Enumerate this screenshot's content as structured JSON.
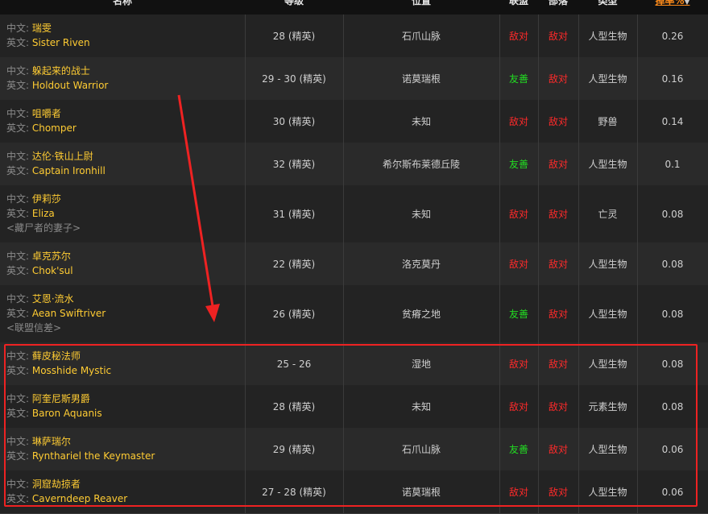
{
  "header": {
    "col_name": "名称",
    "col_level": "等级",
    "col_location": "位置",
    "col_alliance": "联盟",
    "col_horde": "部落",
    "col_type": "类型",
    "col_rate": "掉率%",
    "sort_icon": "chevron-down-icon"
  },
  "labels": {
    "zh": "中文: ",
    "en": "英文: "
  },
  "rows": [
    {
      "zh": "瑞雯",
      "en": "Sister Riven",
      "note": "",
      "level": "28 (精英)",
      "location": "石爪山脉",
      "alliance": "敌对",
      "horde": "敌对",
      "type": "人型生物",
      "rate": "0.26"
    },
    {
      "zh": "躲起来的战士",
      "en": "Holdout Warrior",
      "note": "",
      "level": "29 - 30 (精英)",
      "location": "诺莫瑞根",
      "alliance": "友善",
      "horde": "敌对",
      "type": "人型生物",
      "rate": "0.16"
    },
    {
      "zh": "咀嚼者",
      "en": "Chomper",
      "note": "",
      "level": "30 (精英)",
      "location": "未知",
      "alliance": "敌对",
      "horde": "敌对",
      "type": "野兽",
      "rate": "0.14"
    },
    {
      "zh": "达伦·铁山上尉",
      "en": "Captain Ironhill",
      "note": "",
      "level": "32 (精英)",
      "location": "希尔斯布莱德丘陵",
      "alliance": "友善",
      "horde": "敌对",
      "type": "人型生物",
      "rate": "0.1"
    },
    {
      "zh": "伊莉莎",
      "en": "Eliza",
      "note": "<藏尸者的妻子>",
      "level": "31 (精英)",
      "location": "未知",
      "alliance": "敌对",
      "horde": "敌对",
      "type": "亡灵",
      "rate": "0.08"
    },
    {
      "zh": "卓克苏尔",
      "en": "Chok'sul",
      "note": "",
      "level": "22 (精英)",
      "location": "洛克莫丹",
      "alliance": "敌对",
      "horde": "敌对",
      "type": "人型生物",
      "rate": "0.08"
    },
    {
      "zh": "艾恩·流水",
      "en": "Aean Swiftriver",
      "note": "<联盟信差>",
      "level": "26 (精英)",
      "location": "贫瘠之地",
      "alliance": "友善",
      "horde": "敌对",
      "type": "人型生物",
      "rate": "0.08"
    },
    {
      "zh": "藓皮秘法师",
      "en": "Mosshide Mystic",
      "note": "",
      "level": "25 - 26",
      "location": "湿地",
      "alliance": "敌对",
      "horde": "敌对",
      "type": "人型生物",
      "rate": "0.08"
    },
    {
      "zh": "阿奎尼斯男爵",
      "en": "Baron Aquanis",
      "note": "",
      "level": "28 (精英)",
      "location": "未知",
      "alliance": "敌对",
      "horde": "敌对",
      "type": "元素生物",
      "rate": "0.08"
    },
    {
      "zh": "琳萨瑞尔",
      "en": "Ryntharie​l the Keymaster",
      "note": "",
      "level": "29 (精英)",
      "location": "石爪山脉",
      "alliance": "友善",
      "horde": "敌对",
      "type": "人型生物",
      "rate": "0.06"
    },
    {
      "zh": "洞窟劫掠者",
      "en": "Caverndeep Reaver",
      "note": "",
      "level": "27 - 28 (精英)",
      "location": "诺莫瑞根",
      "alliance": "敌对",
      "horde": "敌对",
      "type": "人型生物",
      "rate": "0.06"
    }
  ],
  "colors": {
    "hostile": "#ff2a2a",
    "friendly": "#22dd22",
    "name": "#ffcc33",
    "highlight": "#ee2222"
  }
}
